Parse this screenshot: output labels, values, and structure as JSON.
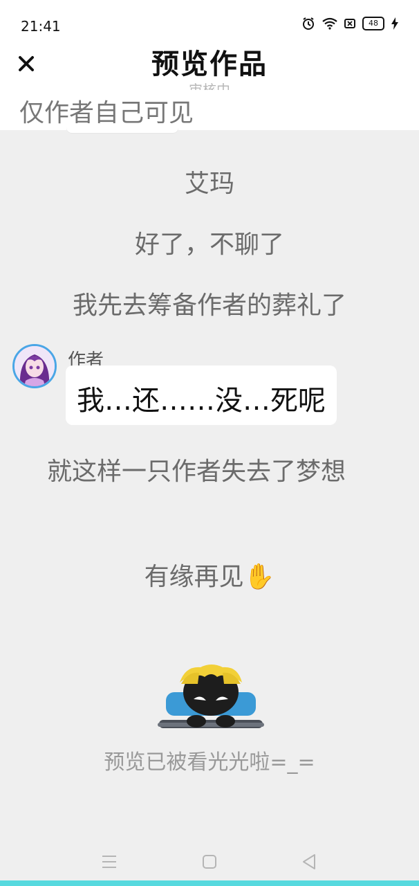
{
  "status_bar": {
    "time": "21:41",
    "battery": "48",
    "icons": [
      "alarm-icon",
      "wifi-icon",
      "sim-off-icon",
      "battery-icon",
      "charging-icon"
    ]
  },
  "header": {
    "title": "预览作品",
    "close_icon": "close-icon",
    "faded_text": "审核中",
    "visibility_note": "仅作者自己可见"
  },
  "story": {
    "narration": [
      "艾玛",
      "好了，不聊了",
      "我先去筹备作者的葬礼了"
    ],
    "dialogue": {
      "speaker": "作者",
      "text": "我…还……没…死呢"
    },
    "paragraph": "就这样一只作者失去了梦想",
    "farewell": "有缘再见✋"
  },
  "end_notice": {
    "text": "预览已被看光光啦=_="
  },
  "nav_bar": {
    "buttons": [
      "menu-icon",
      "home-icon",
      "back-icon"
    ]
  },
  "colors": {
    "accent": "#57d9de",
    "avatar_ring": "#4aa6e6",
    "background": "#efefef"
  }
}
